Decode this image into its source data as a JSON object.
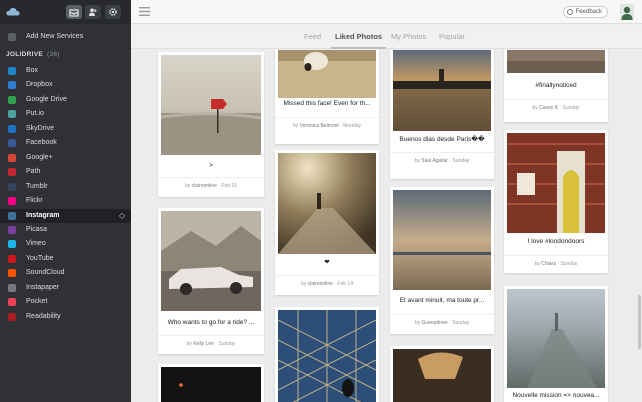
{
  "sidebar": {
    "add_services": "Add New Services",
    "group_name": "JOLIDRIVE",
    "group_count": "(36)",
    "services": [
      {
        "label": "Box",
        "color": "#1e88c7",
        "active": false
      },
      {
        "label": "Dropbox",
        "color": "#2f7fd0",
        "active": false
      },
      {
        "label": "Google Drive",
        "color": "#2f9f4f",
        "active": false
      },
      {
        "label": "Put.io",
        "color": "#4aa3a0",
        "active": false
      },
      {
        "label": "SkyDrive",
        "color": "#1f6fc0",
        "active": false
      },
      {
        "label": "Facebook",
        "color": "#3b5998",
        "active": false
      },
      {
        "label": "Google+",
        "color": "#d34836",
        "active": false
      },
      {
        "label": "Path",
        "color": "#c1272d",
        "active": false
      },
      {
        "label": "Tumblr",
        "color": "#35465c",
        "active": false
      },
      {
        "label": "Flickr",
        "color": "#ff0084",
        "active": false
      },
      {
        "label": "Instagram",
        "color": "#3f729b",
        "active": true
      },
      {
        "label": "Picasa",
        "color": "#7b3fa0",
        "active": false
      },
      {
        "label": "Vimeo",
        "color": "#1ab7ea",
        "active": false
      },
      {
        "label": "YouTube",
        "color": "#cc181e",
        "active": false
      },
      {
        "label": "SoundCloud",
        "color": "#ff5500",
        "active": false
      },
      {
        "label": "Instapaper",
        "color": "#777777",
        "active": false
      },
      {
        "label": "Pocket",
        "color": "#ee4056",
        "active": false
      },
      {
        "label": "Readability",
        "color": "#a81d1d",
        "active": false
      }
    ]
  },
  "topbar": {
    "feedback_label": "Feedback"
  },
  "tabs": [
    {
      "label": "Feed",
      "active": false
    },
    {
      "label": "Liked Photos",
      "active": true
    },
    {
      "label": "My Photos",
      "active": false
    },
    {
      "label": "Popular",
      "active": false
    }
  ],
  "cards": [
    {
      "caption": ">",
      "user": "claireonline",
      "date": "Feb 15"
    },
    {
      "caption": "Who wants to go for a ride? ...",
      "user": "Kelly Lee",
      "date": "Sunday"
    },
    {
      "caption": "Missed this face! Even for th...",
      "user": "Veronica Belmont",
      "date": "Monday"
    },
    {
      "caption": "❤",
      "user": "claireonline",
      "date": "Feb 14"
    },
    {
      "caption": "Buenos dias desde Paris��",
      "user": "Saul Aguilar",
      "date": "Sunday"
    },
    {
      "caption": "Et avant minuit, ma toute pr...",
      "user": "Gueepibree",
      "date": "Sunday"
    },
    {
      "caption": "#finallynoticed",
      "user": "Casey K",
      "date": "Sunday"
    },
    {
      "caption": "I love #londondoors",
      "user": "Chiara",
      "date": "Sunday"
    },
    {
      "caption": "Nouvelle mission => nouvea...",
      "user": "",
      "date": ""
    }
  ]
}
